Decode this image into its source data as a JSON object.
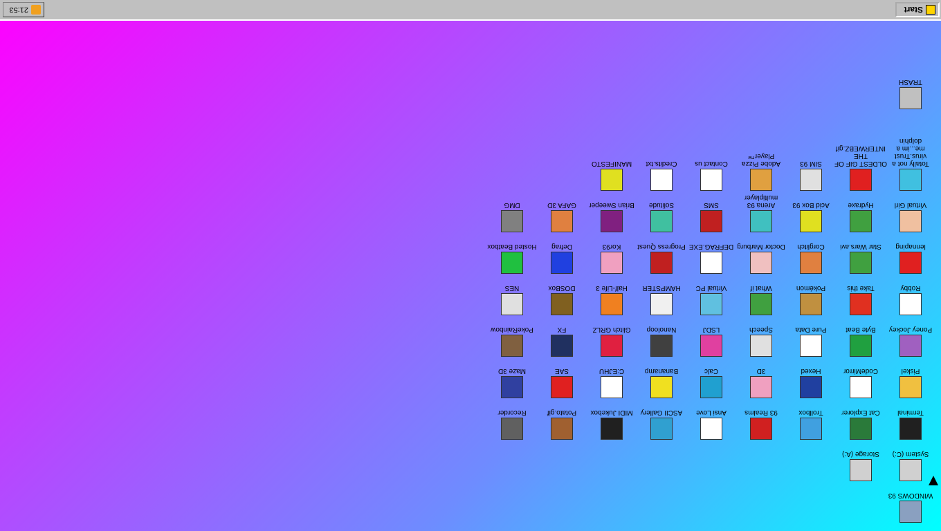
{
  "taskbar": {
    "start_label": "Start",
    "clock": "21:53",
    "icons": {
      "start": "win93-logo-icon",
      "tray": "rss-icon"
    }
  },
  "desktop": {
    "icons": [
      {
        "label": "WINDOWS 93",
        "icon": "computer-icon",
        "color": "#8aa0c0"
      },
      {
        "label": "System (C:)",
        "icon": "drive-icon",
        "color": "#d0d0d0"
      },
      {
        "label": "Storage (A:)",
        "icon": "floppy-icon",
        "color": "#d0d0d0"
      },
      {
        "label": "Terminal",
        "icon": "terminal-icon",
        "color": "#202020"
      },
      {
        "label": "Cat Explorer",
        "icon": "globe-icon",
        "color": "#2a7a3a"
      },
      {
        "label": "Trollbox",
        "icon": "troll-icon",
        "color": "#40a0e0"
      },
      {
        "label": "93 Realms",
        "icon": "dragon-icon",
        "color": "#d02020"
      },
      {
        "label": "Ansi Love",
        "icon": "ansi-icon",
        "color": "#ffffff"
      },
      {
        "label": "ASCII Gallery",
        "icon": "gallery-icon",
        "color": "#30a0d0"
      },
      {
        "label": "MIDI Jukebox",
        "icon": "piano-icon",
        "color": "#202020"
      },
      {
        "label": "Potato.gif",
        "icon": "potato-icon",
        "color": "#a06030"
      },
      {
        "label": "Recorder",
        "icon": "microphone-icon",
        "color": "#606060"
      },
      {
        "label": "Piskel",
        "icon": "palette-icon",
        "color": "#f0c040"
      },
      {
        "label": "CodeMirror",
        "icon": "codemirror-icon",
        "color": "#ffffff"
      },
      {
        "label": "Hexed",
        "icon": "hex-icon",
        "color": "#2040a0"
      },
      {
        "label": "3D",
        "icon": "brain-icon",
        "color": "#f0a0c0"
      },
      {
        "label": "Calc",
        "icon": "calculator-icon",
        "color": "#20a0d0"
      },
      {
        "label": "Bananamp",
        "icon": "banana-icon",
        "color": "#f0e020"
      },
      {
        "label": "C:EJHU",
        "icon": "document-icon",
        "color": "#ffffff"
      },
      {
        "label": "SAE",
        "icon": "ball-icon",
        "color": "#e02020"
      },
      {
        "label": "Maze 3D",
        "icon": "maze-icon",
        "color": "#3040a0"
      },
      {
        "label": "Poney Jockey",
        "icon": "pony-icon",
        "color": "#a060c0"
      },
      {
        "label": "Byte Beat",
        "icon": "wave-icon",
        "color": "#20a040"
      },
      {
        "label": "Pure Data",
        "icon": "puredata-icon",
        "color": "#ffffff"
      },
      {
        "label": "Speech",
        "icon": "face-icon",
        "color": "#e0e0e0"
      },
      {
        "label": "LSDJ",
        "icon": "gameboy-icon",
        "color": "#e040a0"
      },
      {
        "label": "Nanoloop",
        "icon": "loop-icon",
        "color": "#404040"
      },
      {
        "label": "Glitch GRLZ",
        "icon": "lips-icon",
        "color": "#e02040"
      },
      {
        "label": "FX",
        "icon": "atom-icon",
        "color": "#203060"
      },
      {
        "label": "PokeRainbow",
        "icon": "friends-icon",
        "color": "#806040"
      },
      {
        "label": "Robby",
        "icon": "stick-icon",
        "color": "#ffffff"
      },
      {
        "label": "Take this",
        "icon": "mushroom-icon",
        "color": "#e03020"
      },
      {
        "label": "Pokémon",
        "icon": "poke-icon",
        "color": "#c09040"
      },
      {
        "label": "What if",
        "icon": "whatif-icon",
        "color": "#40a040"
      },
      {
        "label": "Virtual PC",
        "icon": "virtualpc-icon",
        "color": "#60c0e0"
      },
      {
        "label": "HAMPSTER",
        "icon": "hamster-icon",
        "color": "#f0f0f0"
      },
      {
        "label": "Half-Life 3",
        "icon": "lambda-icon",
        "color": "#f08020"
      },
      {
        "label": "DOSBox",
        "icon": "dosbox-icon",
        "color": "#806020"
      },
      {
        "label": "NES",
        "icon": "nes-icon",
        "color": "#e0e0e0"
      },
      {
        "label": "lennaping",
        "icon": "pen-icon",
        "color": "#e02020"
      },
      {
        "label": "Star Wars.avi",
        "icon": "yoda-icon",
        "color": "#40a040"
      },
      {
        "label": "Corglitch",
        "icon": "corgi-icon",
        "color": "#e08040"
      },
      {
        "label": "Doctor Marburg",
        "icon": "doctor-icon",
        "color": "#f0c0c0"
      },
      {
        "label": "DEFRAG.EXE",
        "icon": "defrag-icon",
        "color": "#ffffff"
      },
      {
        "label": "Progress Quest",
        "icon": "swords-icon",
        "color": "#c02020"
      },
      {
        "label": "Kor93",
        "icon": "kor-icon",
        "color": "#f0a0c0"
      },
      {
        "label": "Defrag",
        "icon": "cube-icon",
        "color": "#2040e0"
      },
      {
        "label": "Hosted Beatbox",
        "icon": "ring-icon",
        "color": "#20c040"
      },
      {
        "label": "Virtual Girl",
        "icon": "girl-icon",
        "color": "#f0c0a0"
      },
      {
        "label": "Hydraxe",
        "icon": "hydra-icon",
        "color": "#40a040"
      },
      {
        "label": "Acid Box 93",
        "icon": "smiley-icon",
        "color": "#e0e020"
      },
      {
        "label": "Arena 93 multiplayer",
        "icon": "arena-icon",
        "color": "#40c0c0"
      },
      {
        "label": "SMS",
        "icon": "sms-icon",
        "color": "#c02020"
      },
      {
        "label": "Solitude",
        "icon": "phone-icon",
        "color": "#40c0a0"
      },
      {
        "label": "Brian Sweeper",
        "icon": "eye-icon",
        "color": "#802080"
      },
      {
        "label": "GAFA 3D",
        "icon": "head-icon",
        "color": "#e08040"
      },
      {
        "label": "DMG",
        "icon": "console-icon",
        "color": "#808080"
      },
      {
        "label": "Totally not a virus.Trust me...im a dolphin",
        "icon": "dolphin-icon",
        "color": "#40c0e0"
      },
      {
        "label": "OLDEST GIF OF THE INTERWEBZ.gif",
        "icon": "gif-icon",
        "color": "#e02020"
      },
      {
        "label": "SIM 93",
        "icon": "sim-icon",
        "color": "#e0e0e0"
      },
      {
        "label": "Adobe Pizza Player™",
        "icon": "pizza-icon",
        "color": "#e0a040"
      },
      {
        "label": "Contact us",
        "icon": "contact-icon",
        "color": "#ffffff"
      },
      {
        "label": "Credits.txt",
        "icon": "text-file-icon",
        "color": "#ffffff"
      },
      {
        "label": "MANIFESTO",
        "icon": "question-icon",
        "color": "#e0e020"
      },
      {
        "label": "TRASH",
        "icon": "trash-icon",
        "color": "#c0c0c0"
      }
    ]
  }
}
